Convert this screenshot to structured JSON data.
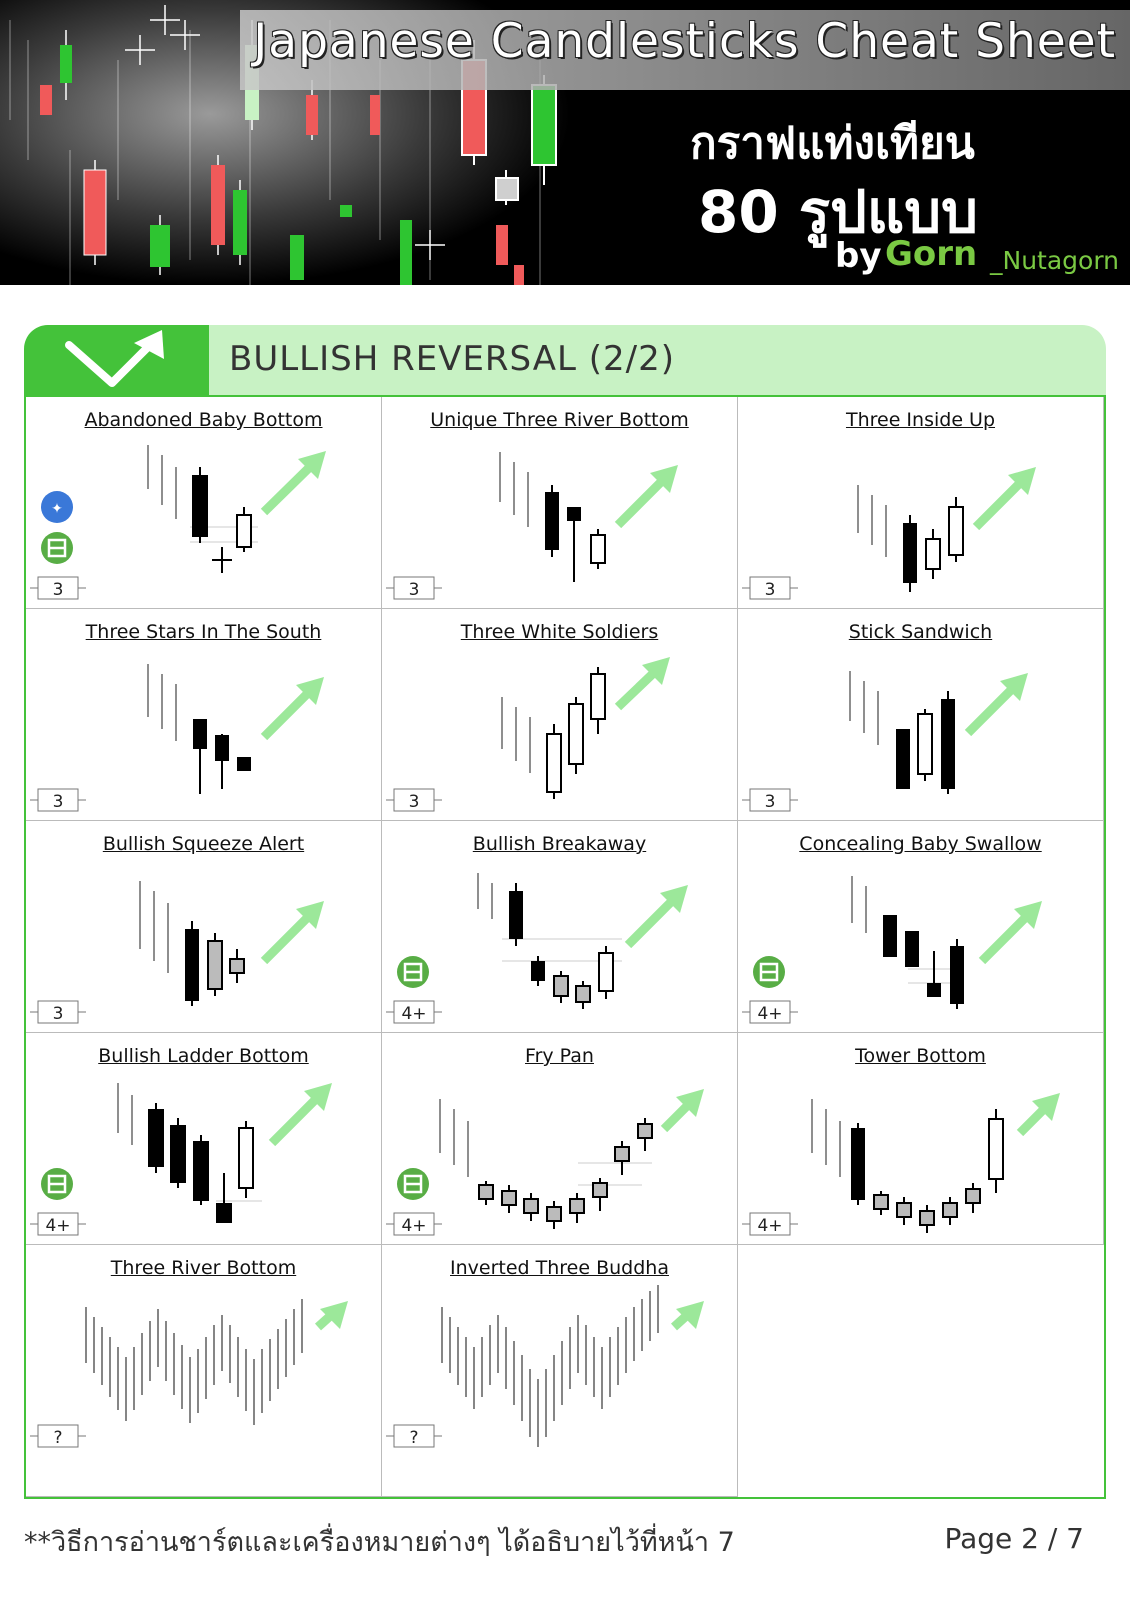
{
  "header": {
    "title": "Japanese Candlesticks Cheat Sheet",
    "thai_line1": "กราฟแท่งเทียน",
    "thai_line2": "80 รูปแบบ",
    "by": "by",
    "brand_first": "Gorn",
    "brand_second": "_Nutagorn"
  },
  "section": {
    "title": "BULLISH  REVERSAL (2/2)",
    "icon": "check-arrow-icon"
  },
  "patterns": [
    {
      "name": "Abandoned Baby Bottom",
      "candles": "3",
      "tags": [
        "star-icon",
        "green-symbol-icon"
      ]
    },
    {
      "name": "Unique Three River Bottom",
      "candles": "3",
      "tags": []
    },
    {
      "name": "Three Inside Up",
      "candles": "3",
      "tags": []
    },
    {
      "name": "Three Stars In The South",
      "candles": "3",
      "tags": []
    },
    {
      "name": "Three White Soldiers",
      "candles": "3",
      "tags": []
    },
    {
      "name": "Stick Sandwich",
      "candles": "3",
      "tags": []
    },
    {
      "name": "Bullish Squeeze Alert",
      "candles": "3",
      "tags": []
    },
    {
      "name": "Bullish Breakaway",
      "candles": "4+",
      "tags": [
        "green-symbol-icon"
      ]
    },
    {
      "name": "Concealing Baby Swallow",
      "candles": "4+",
      "tags": [
        "green-symbol-icon"
      ]
    },
    {
      "name": "Bullish Ladder Bottom",
      "candles": "4+",
      "tags": [
        "green-symbol-icon"
      ]
    },
    {
      "name": "Fry Pan",
      "candles": "4+",
      "tags": [
        "green-symbol-icon"
      ]
    },
    {
      "name": "Tower Bottom",
      "candles": "4+",
      "tags": []
    },
    {
      "name": "Three River Bottom",
      "candles": "?",
      "tags": []
    },
    {
      "name": "Inverted Three Buddha",
      "candles": "?",
      "tags": []
    }
  ],
  "colors": {
    "accent_green": "#44c23a",
    "tab_green": "#c8f2c4",
    "arrow_green": "#9ce89a",
    "header_bull": "#2ec531",
    "header_bear": "#f05a5a"
  },
  "footer": {
    "note": "**วิธีการอ่านชาร์ตและเครื่องหมายต่างๆ ได้อธิบายไว้ที่หน้า 7",
    "page": "Page 2 / 7"
  }
}
